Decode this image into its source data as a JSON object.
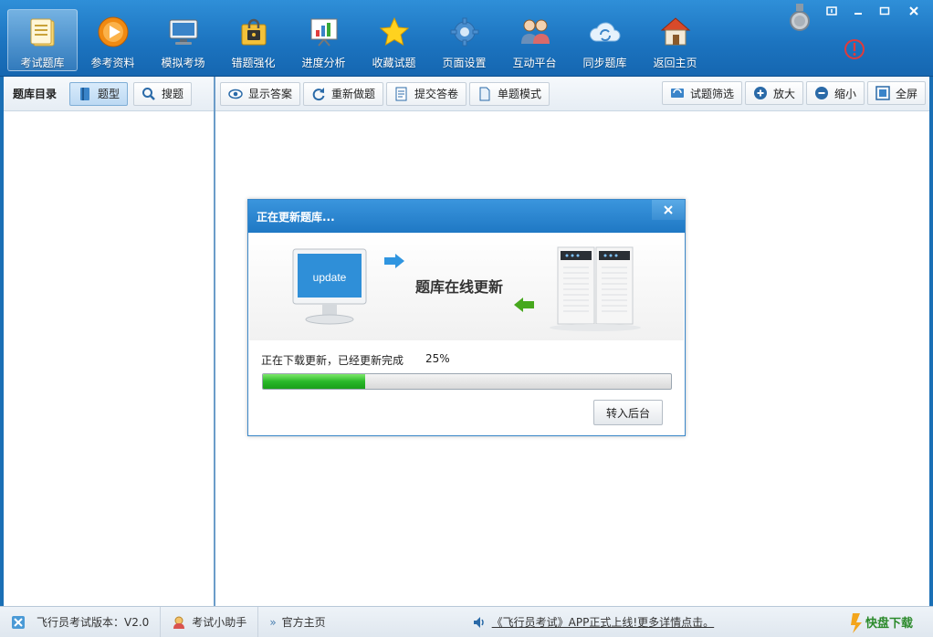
{
  "nav": {
    "items": [
      {
        "label": "考试题库",
        "icon": "notebook-icon",
        "active": true
      },
      {
        "label": "参考资料",
        "icon": "play-disc-icon",
        "active": false
      },
      {
        "label": "模拟考场",
        "icon": "monitor-icon",
        "active": false
      },
      {
        "label": "错题强化",
        "icon": "lock-folder-icon",
        "active": false
      },
      {
        "label": "进度分析",
        "icon": "chart-board-icon",
        "active": false
      },
      {
        "label": "收藏试题",
        "icon": "star-icon",
        "active": false
      },
      {
        "label": "页面设置",
        "icon": "gear-icon",
        "active": false
      },
      {
        "label": "互动平台",
        "icon": "users-icon",
        "active": false
      },
      {
        "label": "同步题库",
        "icon": "cloud-sync-icon",
        "active": false
      },
      {
        "label": "返回主页",
        "icon": "home-icon",
        "active": false
      }
    ]
  },
  "window_controls": [
    "pin-icon",
    "minimize-icon",
    "maximize-icon",
    "close-icon"
  ],
  "sidebar": {
    "title": "题库目录",
    "buttons": [
      {
        "label": "题型",
        "icon": "book-icon",
        "selected": true
      },
      {
        "label": "搜题",
        "icon": "search-icon",
        "selected": false
      }
    ]
  },
  "toolbar": {
    "left": [
      {
        "label": "显示答案",
        "icon": "eye-icon"
      },
      {
        "label": "重新做题",
        "icon": "refresh-icon"
      },
      {
        "label": "提交答卷",
        "icon": "submit-icon"
      },
      {
        "label": "单题模式",
        "icon": "page-icon"
      }
    ],
    "right": [
      {
        "label": "试题筛选",
        "icon": "filter-icon"
      },
      {
        "label": "放大",
        "icon": "zoom-in-icon"
      },
      {
        "label": "缩小",
        "icon": "zoom-out-icon"
      },
      {
        "label": "全屏",
        "icon": "fullscreen-icon"
      }
    ]
  },
  "dialog": {
    "title": "正在更新题库...",
    "monitor_text": "update",
    "banner_text": "题库在线更新",
    "status_text": "正在下载更新，已经更新完成",
    "percent_text": "25%",
    "progress": 0.25,
    "button_label": "转入后台"
  },
  "statusbar": {
    "version": "飞行员考试版本：V2.0",
    "assistant": "考试小助手",
    "homepage": "官方主页",
    "notice": "《飞行员考试》APP正式上线!更多详情点击。",
    "brand_logo_text": "快盘下载"
  },
  "colors": {
    "banner": "#1c74c0",
    "progress_fill": "#29b829",
    "accent_blue": "#3a87c8"
  }
}
